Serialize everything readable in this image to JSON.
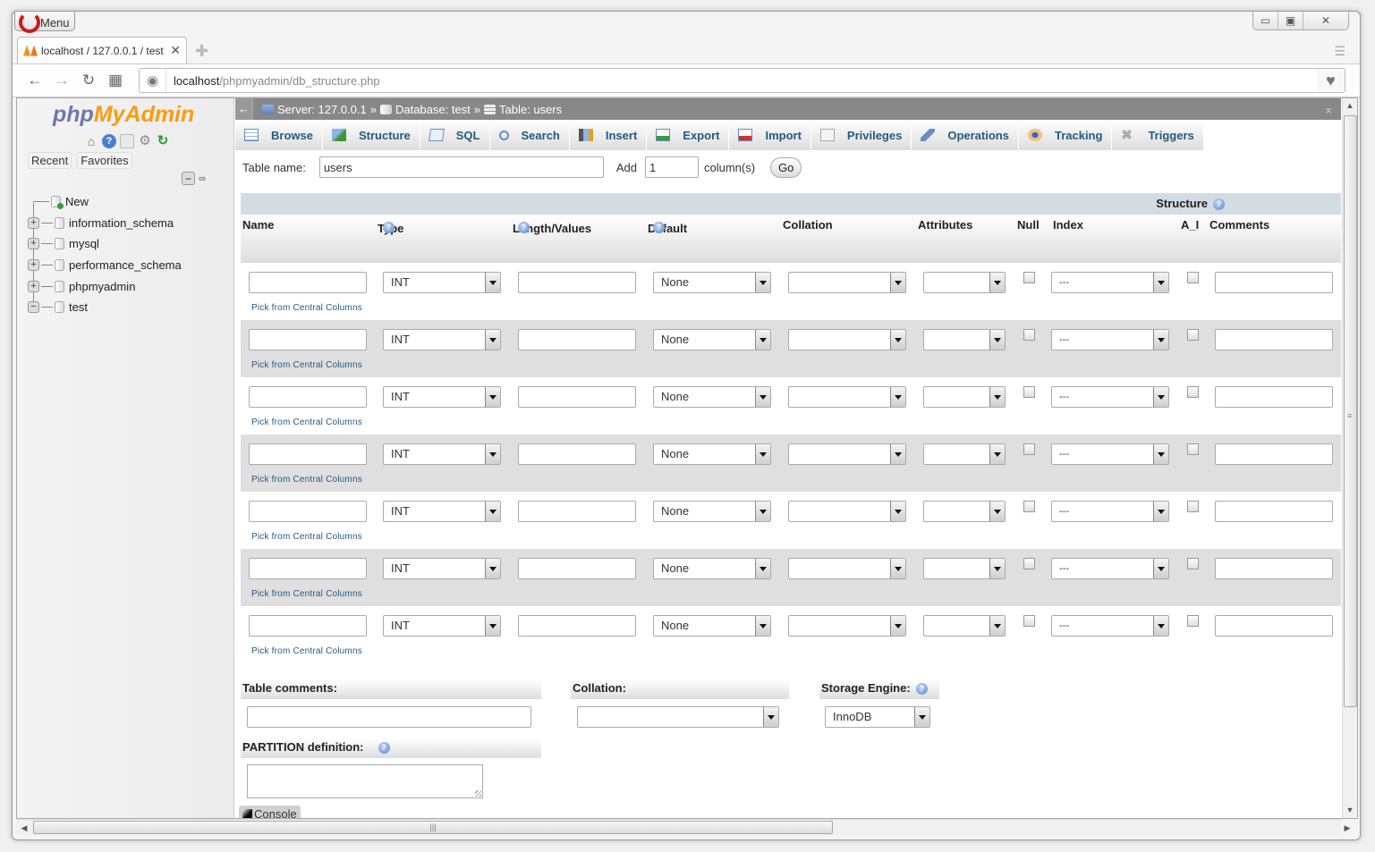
{
  "browser": {
    "menu_label": "Menu",
    "tab_title": "localhost / 127.0.0.1 / test",
    "url_host": "localhost",
    "url_path": "/phpmyadmin/db_structure.php",
    "window_controls": {
      "minimize": "▭",
      "maximize": "▣",
      "close": "✕"
    }
  },
  "sidebar": {
    "logo_php": "php",
    "logo_myadmin": "MyAdmin",
    "tabs": [
      "Recent",
      "Favorites"
    ],
    "new_label": "New",
    "databases": [
      {
        "name": "information_schema",
        "expanded": false
      },
      {
        "name": "mysql",
        "expanded": false
      },
      {
        "name": "performance_schema",
        "expanded": false
      },
      {
        "name": "phpmyadmin",
        "expanded": false
      },
      {
        "name": "test",
        "expanded": true
      }
    ]
  },
  "breadcrumb": {
    "server": "Server: 127.0.0.1",
    "database": "Database: test",
    "table": "Table: users",
    "separator": "»"
  },
  "menu_tabs": [
    "Browse",
    "Structure",
    "SQL",
    "Search",
    "Insert",
    "Export",
    "Import",
    "Privileges",
    "Operations",
    "Tracking",
    "Triggers"
  ],
  "form": {
    "table_name_label": "Table name:",
    "table_name_value": "users",
    "add_label": "Add",
    "add_count": "1",
    "columns_label": "column(s)",
    "go_label": "Go",
    "structure_label": "Structure",
    "headers": {
      "name": "Name",
      "type": "Type",
      "length": "Length/Values",
      "default": "Default",
      "collation": "Collation",
      "attributes": "Attributes",
      "null": "Null",
      "index": "Index",
      "ai": "A_I",
      "comments": "Comments"
    },
    "pick_label": "Pick from Central Columns",
    "rows": [
      {
        "name": "",
        "type": "INT",
        "length": "",
        "default": "None",
        "collation": "",
        "attributes": "",
        "null": false,
        "index": "---",
        "ai": false,
        "comments": ""
      },
      {
        "name": "",
        "type": "INT",
        "length": "",
        "default": "None",
        "collation": "",
        "attributes": "",
        "null": false,
        "index": "---",
        "ai": false,
        "comments": ""
      },
      {
        "name": "",
        "type": "INT",
        "length": "",
        "default": "None",
        "collation": "",
        "attributes": "",
        "null": false,
        "index": "---",
        "ai": false,
        "comments": ""
      },
      {
        "name": "",
        "type": "INT",
        "length": "",
        "default": "None",
        "collation": "",
        "attributes": "",
        "null": false,
        "index": "---",
        "ai": false,
        "comments": ""
      },
      {
        "name": "",
        "type": "INT",
        "length": "",
        "default": "None",
        "collation": "",
        "attributes": "",
        "null": false,
        "index": "---",
        "ai": false,
        "comments": ""
      },
      {
        "name": "",
        "type": "INT",
        "length": "",
        "default": "None",
        "collation": "",
        "attributes": "",
        "null": false,
        "index": "---",
        "ai": false,
        "comments": ""
      },
      {
        "name": "",
        "type": "INT",
        "length": "",
        "default": "None",
        "collation": "",
        "attributes": "",
        "null": false,
        "index": "---",
        "ai": false,
        "comments": ""
      }
    ],
    "table_comments_label": "Table comments:",
    "table_comments_value": "",
    "collation_label": "Collation:",
    "collation_value": "",
    "storage_engine_label": "Storage Engine:",
    "storage_engine_value": "InnoDB",
    "partition_label": "PARTITION definition:",
    "partition_value": ""
  },
  "console_label": "Console"
}
